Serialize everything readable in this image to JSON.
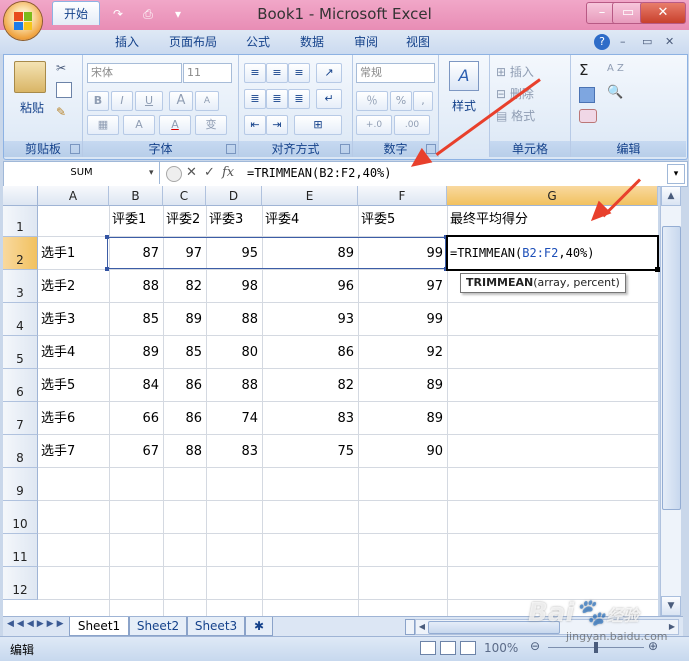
{
  "window": {
    "title": "Book1 - Microsoft Excel",
    "minimize": "–",
    "restore": "▭",
    "close": "✕"
  },
  "qat": {
    "save": "▣",
    "undo": "↶",
    "redo": "↷",
    "print": "⎙",
    "more": "▾"
  },
  "ribbon_tabs": [
    "开始",
    "插入",
    "页面布局",
    "公式",
    "数据",
    "审阅",
    "视图"
  ],
  "ribbon_right": {
    "help": "?",
    "min": "–",
    "restore": "▭",
    "close": "✕"
  },
  "groups": {
    "clipboard": {
      "label": "剪贴板",
      "paste": "粘贴"
    },
    "font": {
      "label": "字体",
      "font_name": "宋体",
      "font_size": "11",
      "bold": "B",
      "italic": "I",
      "underline": "U",
      "grow": "A",
      "shrink": "A",
      "fill": "A",
      "color": "A",
      "phonetic": "变"
    },
    "alignment": {
      "label": "对齐方式"
    },
    "number": {
      "label": "数字",
      "format": "常规",
      "currency": "％",
      "percent": "%",
      "comma": ",",
      "dec_inc": "+.0",
      "dec_dec": ".00"
    },
    "styles": {
      "label": "样式",
      "icon": "A"
    },
    "cells": {
      "label": "单元格",
      "insert": "插入",
      "delete": "删除",
      "format": "格式"
    },
    "editing": {
      "label": "编辑",
      "sum": "Σ",
      "sort": "A Z",
      "find": "🔍"
    }
  },
  "formula_bar": {
    "name_box": "SUM",
    "cancel": "✕",
    "enter": "✓",
    "fx": "fx",
    "formula": "=TRIMMEAN(B2:F2,40%)"
  },
  "columns": [
    "A",
    "B",
    "C",
    "D",
    "E",
    "F",
    "G"
  ],
  "rows": [
    "1",
    "2",
    "3",
    "4",
    "5",
    "6",
    "7",
    "8",
    "9",
    "10",
    "11",
    "12"
  ],
  "header_row": [
    "",
    "评委1",
    "评委2",
    "评委3",
    "评委4",
    "评委5",
    "最终平均得分"
  ],
  "data_rows": [
    {
      "name": "选手1",
      "scores": [
        "87",
        "97",
        "95",
        "89",
        "99"
      ]
    },
    {
      "name": "选手2",
      "scores": [
        "88",
        "82",
        "98",
        "96",
        "97"
      ]
    },
    {
      "name": "选手3",
      "scores": [
        "85",
        "89",
        "88",
        "93",
        "99"
      ]
    },
    {
      "name": "选手4",
      "scores": [
        "89",
        "85",
        "80",
        "86",
        "92"
      ]
    },
    {
      "name": "选手5",
      "scores": [
        "84",
        "86",
        "88",
        "82",
        "89"
      ]
    },
    {
      "name": "选手6",
      "scores": [
        "66",
        "86",
        "74",
        "83",
        "89"
      ]
    },
    {
      "name": "选手7",
      "scores": [
        "67",
        "88",
        "83",
        "75",
        "90"
      ]
    }
  ],
  "active_cell": {
    "prefix": "=TRIMMEAN(",
    "ref": "B2:F2",
    "suffix": ",40%)"
  },
  "tooltip": {
    "func": "TRIMMEAN",
    "args": "(array, percent)"
  },
  "sheets": [
    "Sheet1",
    "Sheet2",
    "Sheet3"
  ],
  "status": {
    "mode": "编辑",
    "zoom": "100%"
  },
  "watermark": {
    "brand": "Bai",
    "brand2": "经验",
    "url": "jingyan.baidu.com"
  }
}
